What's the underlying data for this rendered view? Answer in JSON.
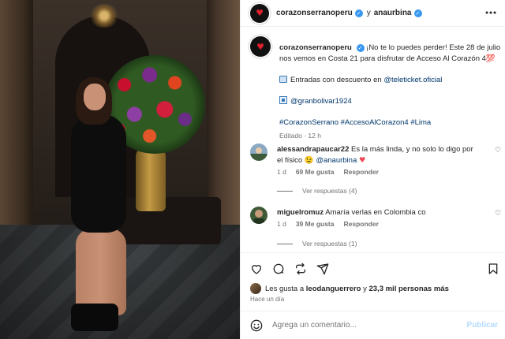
{
  "header": {
    "account": "corazonserranoperu",
    "connector": "y",
    "collaborator": "anaurbina"
  },
  "caption": {
    "username": "corazonserranoperu",
    "text": "¡No te lo puedes perder! Este 28 de julio nos vemos en Costa 21 para disfrutar de Acceso Al Corazón 4💯",
    "tickets_text": "Entradas con descuento en",
    "tickets_link": "@teleticket.oficial",
    "venue_link": "@granbolivar1924",
    "hashtags": "#CorazonSerrano #AccesoAlCorazon4 #Lima",
    "edited": "Editado · 12 h"
  },
  "comments": [
    {
      "username": "alessandrapaucar22",
      "text": "Es la más linda, y no solo lo digo por el físico 😉",
      "mention": "@anaurbina",
      "age": "1 d",
      "likes": "69 Me gusta",
      "reply": "Responder",
      "replies": "Ver respuestas (4)"
    },
    {
      "username": "miguelromuz",
      "text": "Amaría verlas en Colombia co",
      "age": "1 d",
      "likes": "39 Me gusta",
      "reply": "Responder",
      "replies": "Ver respuestas (1)"
    }
  ],
  "likes": {
    "prefix": "Les gusta a",
    "user": "leodanguerrero",
    "connector": "y",
    "others": "23,3 mil personas más"
  },
  "timestamp": "Hace un día",
  "add_comment": {
    "placeholder": "Agrega un comentario...",
    "post_label": "Publicar"
  },
  "colors": {
    "link": "#00376b",
    "verified": "#3897f0",
    "muted": "#737373",
    "post_disabled": "#b3dbff",
    "heart_red": "#ed4956"
  }
}
